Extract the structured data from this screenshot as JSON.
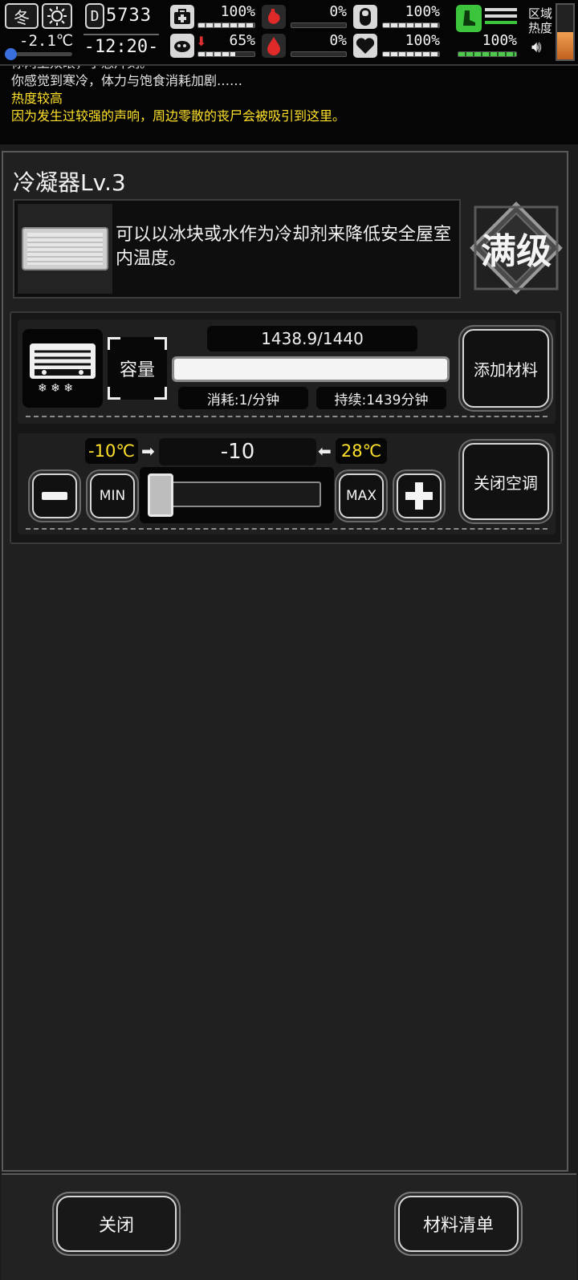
{
  "status": {
    "season": "冬",
    "temperature": "-2.1℃",
    "day": "5733",
    "time": "-12:20-",
    "stats": [
      {
        "name": "health",
        "value": "100%",
        "level": 1.0
      },
      {
        "name": "hunger",
        "value": "0%",
        "level": 0.0
      },
      {
        "name": "sanity",
        "value": "100%",
        "level": 1.0
      },
      {
        "name": "stamina",
        "value": "65%",
        "level": 0.65
      },
      {
        "name": "thirst",
        "value": "0%",
        "level": 0.0
      },
      {
        "name": "mood",
        "value": "100%",
        "level": 1.0
      },
      {
        "name": "hygiene",
        "value": "100%",
        "level": 1.0
      }
    ],
    "region_heat_label": "区域\n热度",
    "region_heat_line1": "区域",
    "region_heat_line2": "热度"
  },
  "log": {
    "cut_line": "你两上双眼，小憩片刻。",
    "line1": "你感觉到寒冷，体力与饱食消耗加剧……",
    "line2": "热度较高",
    "line3": "因为发生过较强的声响，周边零散的丧尸会被吸引到这里。"
  },
  "building": {
    "title": "冷凝器Lv.3",
    "description": "可以以冰块或水作为冷却剂来降低安全屋室内温度。",
    "max_badge": "满级"
  },
  "capacity": {
    "label": "容量",
    "value": "1438.9/1440",
    "fill_fraction": 0.9993,
    "consumption": "消耗:1/分钟",
    "duration": "持续:1439分钟",
    "add_button": "添加材料"
  },
  "thermostat": {
    "min_label": "-10℃",
    "current": "-10",
    "max_label": "28℃",
    "min_btn": "MIN",
    "max_btn": "MAX",
    "slider_fraction": 0.0,
    "off_button": "关闭空调"
  },
  "footer": {
    "close": "关闭",
    "materials": "材料清单"
  }
}
